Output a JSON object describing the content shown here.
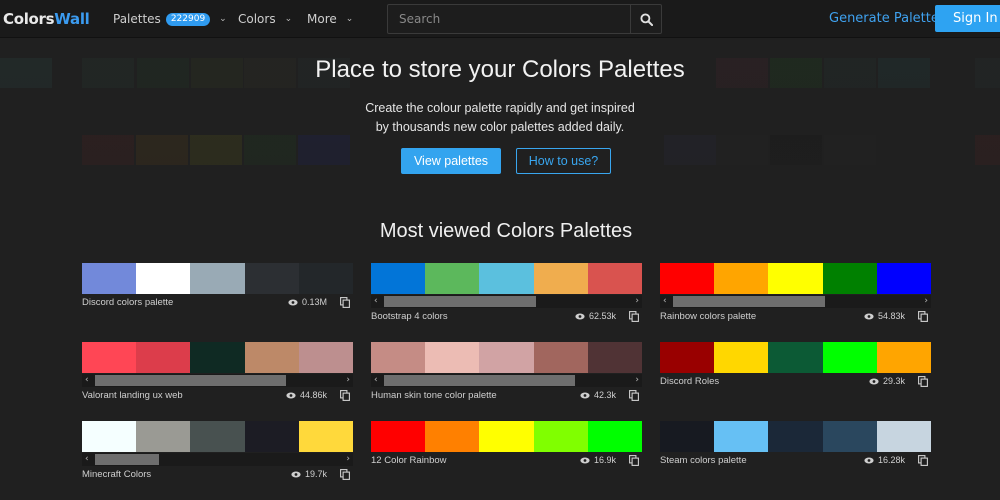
{
  "nav": {
    "logo_part1": "Colors",
    "logo_part2": "Wall",
    "palettes_label": "Palettes",
    "palettes_count": "222909",
    "colors_label": "Colors",
    "more_label": "More",
    "search_placeholder": "Search",
    "generate_label": "Generate Palette",
    "signin_label": "Sign In"
  },
  "hero": {
    "title": "Place to store your Colors Palettes",
    "subtitle_line1": "Create the colour palette rapidly and get inspired",
    "subtitle_line2": "by thousands new color palettes added daily.",
    "view_button": "View palettes",
    "howto_button": "How to use?"
  },
  "section": {
    "title": "Most viewed Colors Palettes"
  },
  "background_rows": [
    {
      "colors": [
        "#2c5a58",
        "#2a4a3a",
        "#1f4a2a",
        "#3a4a22",
        "#3b3b2a",
        "#2a3a3a",
        "#5a2430",
        "#1b5a1b",
        "#24403a",
        "#1e5050",
        "#2a3d3d",
        "#2a5a5a"
      ]
    },
    {
      "colors": [
        "#7a1a1a",
        "#8a5a10",
        "#8a8a10",
        "#1a5a1a",
        "#15209a",
        "#33305a",
        "#2a2a2a",
        "#0a0a0a",
        "#2a2a2a",
        "#7a1a1a"
      ]
    }
  ],
  "palettes": [
    {
      "name": "Discord colors palette",
      "views": "0.13M",
      "colors": [
        "#7289da",
        "#ffffff",
        "#99aab5",
        "#2c2f33",
        "#23272a"
      ],
      "scrollbar": false
    },
    {
      "name": "Bootstrap 4 colors",
      "views": "62.53k",
      "colors": [
        "#0275d8",
        "#5cb85c",
        "#5bc0de",
        "#f0ad4e",
        "#d9534f"
      ],
      "scrollbar": true,
      "scroll_fraction": 0.62
    },
    {
      "name": "Rainbow colors palette",
      "views": "54.83k",
      "colors": [
        "#ff0000",
        "#ffa500",
        "#ffff00",
        "#008000",
        "#0000ff"
      ],
      "scrollbar": true,
      "scroll_fraction": 0.62
    },
    {
      "name": "Valorant landing ux web",
      "views": "44.86k",
      "colors": [
        "#ff4655",
        "#dc3d4b",
        "#0f2a23",
        "#bd8968",
        "#bd8f8f"
      ],
      "scrollbar": true,
      "scroll_fraction": 0.78
    },
    {
      "name": "Human skin tone color palette",
      "views": "42.3k",
      "colors": [
        "#c58c85",
        "#ecbcb4",
        "#d1a3a4",
        "#a1665e",
        "#503335"
      ],
      "scrollbar": true,
      "scroll_fraction": 0.78
    },
    {
      "name": "Discord Roles",
      "views": "29.3k",
      "colors": [
        "#990000",
        "#ffd700",
        "#0c5a35",
        "#00ff00",
        "#ffa500"
      ],
      "scrollbar": false
    },
    {
      "name": "Minecraft Colors",
      "views": "19.7k",
      "colors": [
        "#f5ffff",
        "#9a9a94",
        "#485150",
        "#1c1c24",
        "#ffd93b"
      ],
      "scrollbar": true,
      "scroll_fraction": 0.26
    },
    {
      "name": "12 Color Rainbow",
      "views": "16.9k",
      "colors": [
        "#ff0000",
        "#ff8000",
        "#ffff00",
        "#80ff00",
        "#00ff00"
      ],
      "scrollbar": false
    },
    {
      "name": "Steam colors palette",
      "views": "16.28k",
      "colors": [
        "#171a21",
        "#66c0f4",
        "#1b2838",
        "#2a475e",
        "#c7d5e0"
      ],
      "scrollbar": false
    }
  ]
}
